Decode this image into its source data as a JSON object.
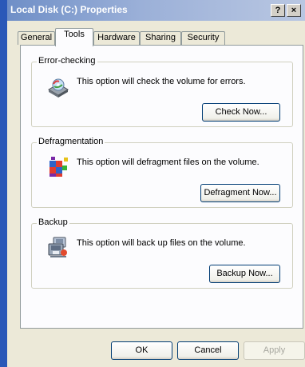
{
  "window": {
    "title": "Local Disk (C:) Properties",
    "help_label": "?",
    "close_label": "×"
  },
  "tabs": [
    {
      "label": "General"
    },
    {
      "label": "Tools"
    },
    {
      "label": "Hardware"
    },
    {
      "label": "Sharing"
    },
    {
      "label": "Security"
    }
  ],
  "active_tab": "Tools",
  "groups": {
    "error_checking": {
      "title": "Error-checking",
      "text": "This option will check the volume for errors.",
      "button": "Check Now...",
      "icon": "disk-check-icon"
    },
    "defragmentation": {
      "title": "Defragmentation",
      "text": "This option will defragment files on the volume.",
      "button": "Defragment Now...",
      "icon": "defrag-icon"
    },
    "backup": {
      "title": "Backup",
      "text": "This option will back up files on the volume.",
      "button": "Backup Now...",
      "icon": "backup-icon"
    }
  },
  "footer": {
    "ok": "OK",
    "cancel": "Cancel",
    "apply": "Apply"
  },
  "colors": {
    "titlebar_start": "#6f8fc7",
    "window_bg": "#ece9d8",
    "panel_bg": "#fcfcfe",
    "accent_border": "#2a58b8"
  }
}
